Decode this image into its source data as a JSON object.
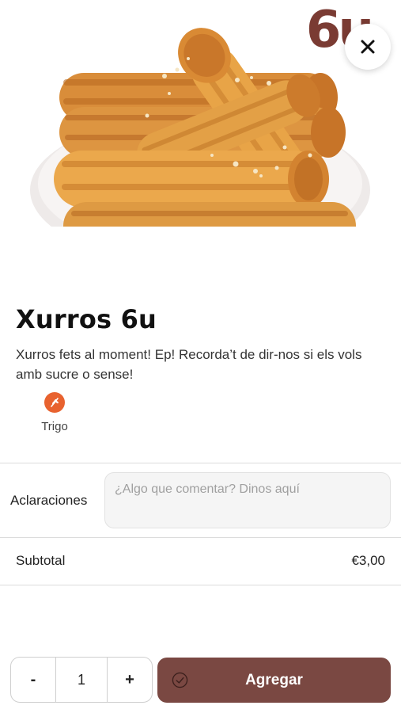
{
  "product": {
    "brand_mark": "6u",
    "title": "Xurros 6u",
    "description": "Xurros fets al moment! Ep! Recorda’t de dir-nos si els vols amb sucre o sense!",
    "image_icon": "churros-plate-image"
  },
  "header": {
    "close_icon": "close-icon"
  },
  "allergens": [
    {
      "label": "Trigo",
      "icon": "wheat-icon",
      "color": "#e8622f"
    }
  ],
  "clarifications": {
    "label": "Aclaraciones",
    "placeholder": "¿Algo que comentar? Dinos aquí",
    "value": ""
  },
  "subtotal": {
    "label": "Subtotal",
    "value": "€3,00"
  },
  "cart": {
    "minus_label": "-",
    "quantity": "1",
    "plus_label": "+",
    "add_label": "Agregar",
    "accent_color": "#7a4842"
  }
}
